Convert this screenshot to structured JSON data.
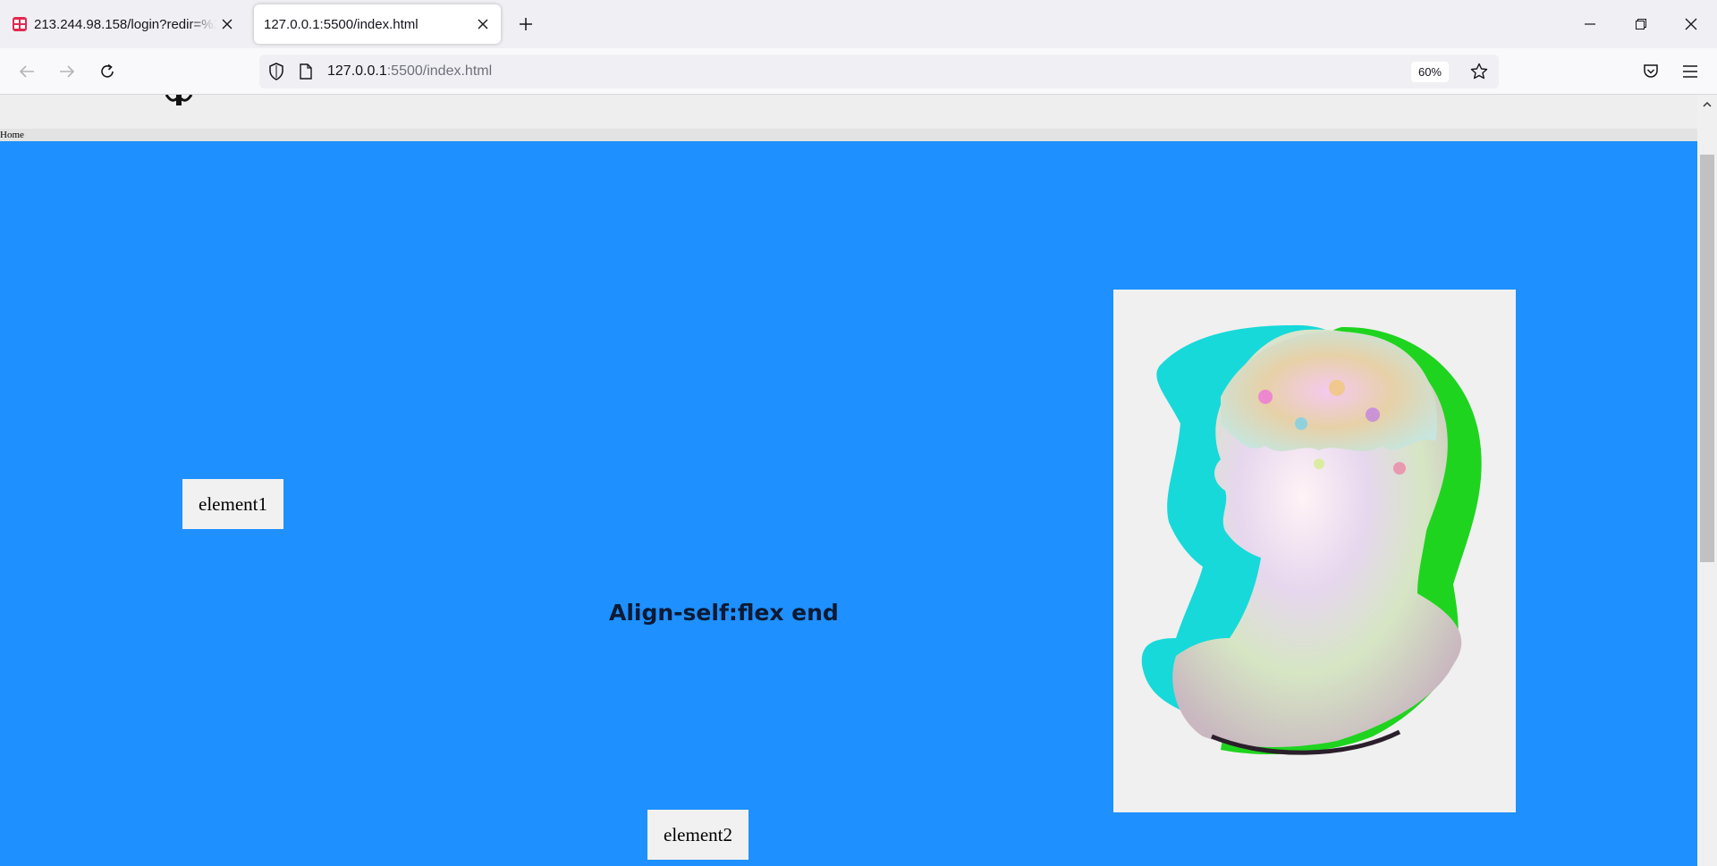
{
  "browser": {
    "tabs": [
      {
        "title": "213.244.98.158/login?redir=%2F",
        "active": false,
        "favicon": "app-favicon",
        "favicon_color": "#e22850"
      },
      {
        "title": "127.0.0.1:5500/index.html",
        "active": true
      }
    ],
    "new_tab_icon": "plus-icon",
    "window_controls": [
      "minimize-icon",
      "restore-icon",
      "close-icon"
    ],
    "nav": {
      "back_icon": "back-arrow-icon",
      "forward_icon": "forward-arrow-icon",
      "reload_icon": "reload-icon"
    },
    "url": {
      "host": "127.0.0.1",
      "rest": ":5500/index.html"
    },
    "zoom": "60%",
    "toolbar_icons": [
      "shield-icon",
      "page-icon",
      "star-icon",
      "pocket-icon",
      "menu-icon"
    ]
  },
  "page": {
    "nav_link": "Home",
    "element1": "element1",
    "element2": "element2",
    "caption": "Align-self:flex end",
    "background_color": "#1e90ff",
    "image": "glitched-statue-bust-image"
  }
}
